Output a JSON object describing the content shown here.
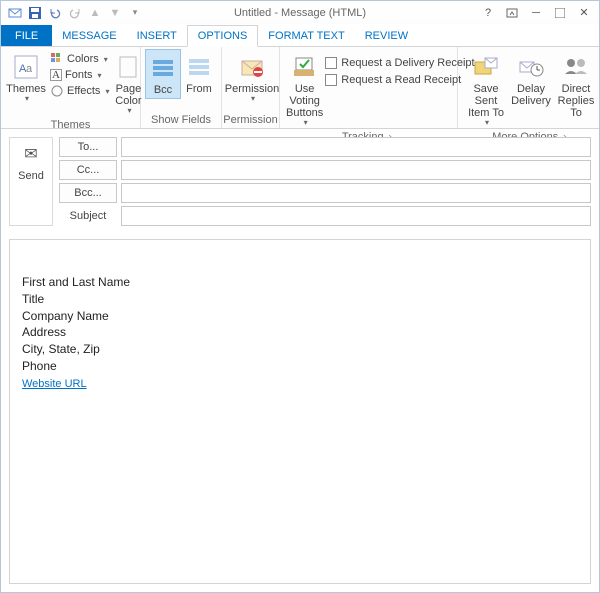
{
  "title": "Untitled - Message (HTML)",
  "tabs": {
    "file": "FILE",
    "message": "MESSAGE",
    "insert": "INSERT",
    "options": "OPTIONS",
    "format": "FORMAT TEXT",
    "review": "REVIEW"
  },
  "ribbon": {
    "themes": {
      "title": "Themes",
      "themes": "Themes",
      "colors": "Colors",
      "fonts": "Fonts",
      "effects": "Effects",
      "pageColor": "Page Color"
    },
    "showFields": {
      "title": "Show Fields",
      "bcc": "Bcc",
      "from": "From"
    },
    "permission": {
      "title": "Permission",
      "permission": "Permission"
    },
    "tracking": {
      "title": "Tracking",
      "voting": "Use Voting Buttons",
      "delivery": "Request a Delivery Receipt",
      "read": "Request a Read Receipt"
    },
    "more": {
      "title": "More Options",
      "saveSent": "Save Sent Item To",
      "delay": "Delay Delivery",
      "direct": "Direct Replies To"
    }
  },
  "envelope": {
    "send": "Send",
    "to": "To...",
    "cc": "Cc...",
    "bcc": "Bcc...",
    "subject": "Subject",
    "toVal": "",
    "ccVal": "",
    "bccVal": "",
    "subjectVal": ""
  },
  "body": {
    "l1": "First and Last Name",
    "l2": "Title",
    "l3": "Company Name",
    "l4": "Address",
    "l5": "City, State, Zip",
    "l6": "Phone",
    "l7": "Website URL"
  }
}
